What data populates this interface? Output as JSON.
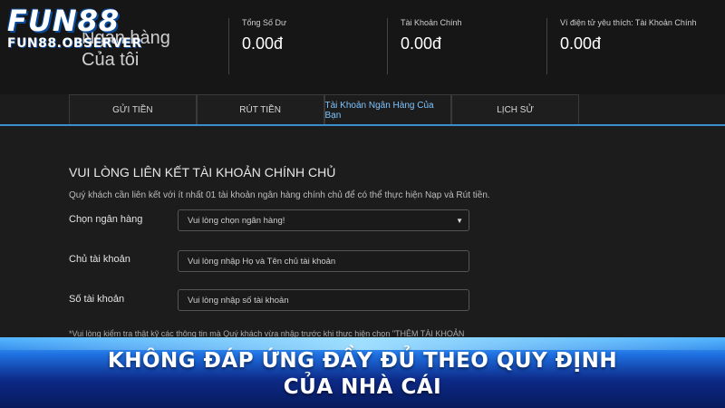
{
  "logo": {
    "main": "FUN88",
    "sub": "FUN88.OBSERVER"
  },
  "header": {
    "title_line1": "Ngân hàng",
    "title_line2": "Của tôi"
  },
  "balances": [
    {
      "label": "Tổng Số Dư",
      "value": "0.00đ"
    },
    {
      "label": "Tài Khoản Chính",
      "value": "0.00đ"
    },
    {
      "label": "Ví điện tử yêu thích: Tài Khoản Chính",
      "value": "0.00đ"
    }
  ],
  "tabs": [
    {
      "label": "GỬI TIỀN"
    },
    {
      "label": "RÚT TIỀN"
    },
    {
      "label": "Tài Khoản Ngân Hàng Của Bạn"
    },
    {
      "label": "LỊCH SỬ"
    }
  ],
  "form": {
    "title": "VUI LÒNG LIÊN KẾT TÀI KHOẢN CHÍNH CHỦ",
    "description": "Quý khách cần liên kết với ít nhất 01 tài khoản ngân hàng chính chủ để có thể thực hiện Nạp và Rút tiền.",
    "bank_label": "Chọn ngân hàng",
    "bank_placeholder": "Vui lòng chọn ngân hàng!",
    "holder_label": "Chủ tài khoản",
    "holder_placeholder": "Vui lòng nhập Họ và Tên chủ tài khoản",
    "number_label": "Số tài khoản",
    "number_placeholder": "Vui lòng nhập số tài khoản",
    "note": "*Vui lòng kiểm tra thật kỹ các thông tin mà Quý khách vừa nhập trước khi thực hiện chọn \"THÊM TÀI KHOẢN"
  },
  "banner": {
    "line1": "KHÔNG ĐÁP ỨNG ĐẦY ĐỦ THEO QUY ĐỊNH",
    "line2": "CỦA NHÀ CÁI"
  },
  "colors": {
    "accent": "#3a8fd0",
    "active_tab": "#7fc4ff",
    "banner": "#1e6fe0"
  }
}
